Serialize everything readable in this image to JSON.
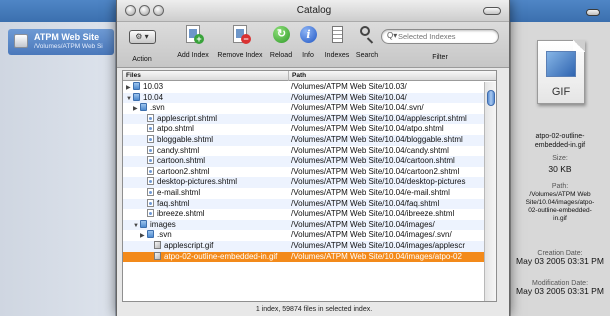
{
  "background_window": {
    "sidebar_item": {
      "name": "ATPM Web Site",
      "path": "/Volumes/ATPM Web Si"
    }
  },
  "window": {
    "title": "Catalog"
  },
  "toolbar": {
    "action": "Action",
    "add_index": "Add Index",
    "remove_index": "Remove Index",
    "reload": "Reload",
    "info": "Info",
    "indexes": "Indexes",
    "search": "Search",
    "filter_label": "Filter",
    "filter_placeholder": "Selected Indexes"
  },
  "table": {
    "columns": {
      "files": "Files",
      "path": "Path"
    },
    "rows": [
      {
        "name": "10.03",
        "path": "/Volumes/ATPM Web Site/10.03/",
        "icon": "folder-icon",
        "expanded": false
      },
      {
        "name": "10.04",
        "path": "/Volumes/ATPM Web Site/10.04/",
        "icon": "folder-icon",
        "expanded": true
      },
      {
        "name": ".svn",
        "path": "/Volumes/ATPM Web Site/10.04/.svn/",
        "icon": "folder-icon",
        "expanded": false
      },
      {
        "name": "applescript.shtml",
        "path": "/Volumes/ATPM Web Site/10.04/applescript.shtml",
        "icon": "document-icon"
      },
      {
        "name": "atpo.shtml",
        "path": "/Volumes/ATPM Web Site/10.04/atpo.shtml",
        "icon": "document-icon"
      },
      {
        "name": "bloggable.shtml",
        "path": "/Volumes/ATPM Web Site/10.04/bloggable.shtml",
        "icon": "document-icon"
      },
      {
        "name": "candy.shtml",
        "path": "/Volumes/ATPM Web Site/10.04/candy.shtml",
        "icon": "document-icon"
      },
      {
        "name": "cartoon.shtml",
        "path": "/Volumes/ATPM Web Site/10.04/cartoon.shtml",
        "icon": "document-icon"
      },
      {
        "name": "cartoon2.shtml",
        "path": "/Volumes/ATPM Web Site/10.04/cartoon2.shtml",
        "icon": "document-icon"
      },
      {
        "name": "desktop-pictures.shtml",
        "path": "/Volumes/ATPM Web Site/10.04/desktop-pictures",
        "icon": "document-icon"
      },
      {
        "name": "e-mail.shtml",
        "path": "/Volumes/ATPM Web Site/10.04/e-mail.shtml",
        "icon": "document-icon"
      },
      {
        "name": "faq.shtml",
        "path": "/Volumes/ATPM Web Site/10.04/faq.shtml",
        "icon": "document-icon"
      },
      {
        "name": "ibreeze.shtml",
        "path": "/Volumes/ATPM Web Site/10.04/ibreeze.shtml",
        "icon": "document-icon"
      },
      {
        "name": "images",
        "path": "/Volumes/ATPM Web Site/10.04/images/",
        "icon": "folder-icon",
        "expanded": true
      },
      {
        "name": ".svn",
        "path": "/Volumes/ATPM Web Site/10.04/images/.svn/",
        "icon": "folder-icon",
        "expanded": false
      },
      {
        "name": "applescript.gif",
        "path": "/Volumes/ATPM Web Site/10.04/images/applescr",
        "icon": "image-icon"
      },
      {
        "name": "atpo-02-outline-embedded-in.gif",
        "path": "/Volumes/ATPM Web Site/10.04/images/atpo-02",
        "icon": "image-icon",
        "selected": true
      }
    ]
  },
  "status": "1 index, 59874 files in selected index.",
  "info_panel": {
    "file_kind": "GIF",
    "file_name": "atpo-02-outline-embedded-in.gif",
    "size_label": "Size:",
    "size_value": "30 KB",
    "path_label": "Path:",
    "path_value": "/Volumes/ATPM Web Site/10.04/images/atpo-02-outline-embedded-in.gif",
    "creation_label": "Creation Date:",
    "creation_value": "May 03 2005 03:31 PM",
    "modification_label": "Modification Date:",
    "modification_value": "May 03 2005 03:31 PM"
  },
  "colors": {
    "selection": "#f38a1a",
    "alternate_row": "#edf3fe",
    "sidebar_selection": "#4a78bb"
  }
}
